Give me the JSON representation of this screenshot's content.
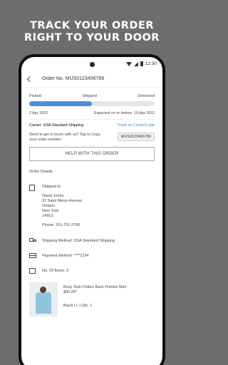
{
  "promo": {
    "line1": "TRACK YOUR ORDER",
    "line2": "RIGHT TO YOUR DOOR"
  },
  "status_bar": {
    "time": "12:30"
  },
  "app_bar": {
    "title": "Order No. MUS0123456789"
  },
  "progress": {
    "steps": [
      "Picked",
      "Shipped",
      "Delivered"
    ],
    "fraction": 0.5
  },
  "dates": {
    "order_date": "2 Apr 2022",
    "expected": "Expected on or before: 10 Apr 2022"
  },
  "carrier": {
    "label": "Carrier: USA Standard Shipping",
    "link": "Track on Carrier's site"
  },
  "help": {
    "prompt": "Need to get in touch with us? Tap to Copy your order number:",
    "order_number": "MUS0123456789",
    "button": "HELP WITH THIS ORDER"
  },
  "order_details": {
    "title": "Order Details",
    "shipped_to": {
      "label": "Shipped to",
      "name": "David Jones",
      "street": "32 Saint Marys Avenue",
      "state": "Ontario",
      "city": "New York",
      "zip": "14913",
      "phone": "Phone: 315-791-2795"
    },
    "shipping_method": "Shipping Method: USA Standard Shipping",
    "payment_method": "Payment Method: ****1234",
    "items_count": "No. Of Items: 3"
  },
  "product": {
    "name": "Boxy Slub Ombre Back Printed Shirt",
    "price": "$30.00*",
    "variant": "Black I L I Qty: 1"
  }
}
